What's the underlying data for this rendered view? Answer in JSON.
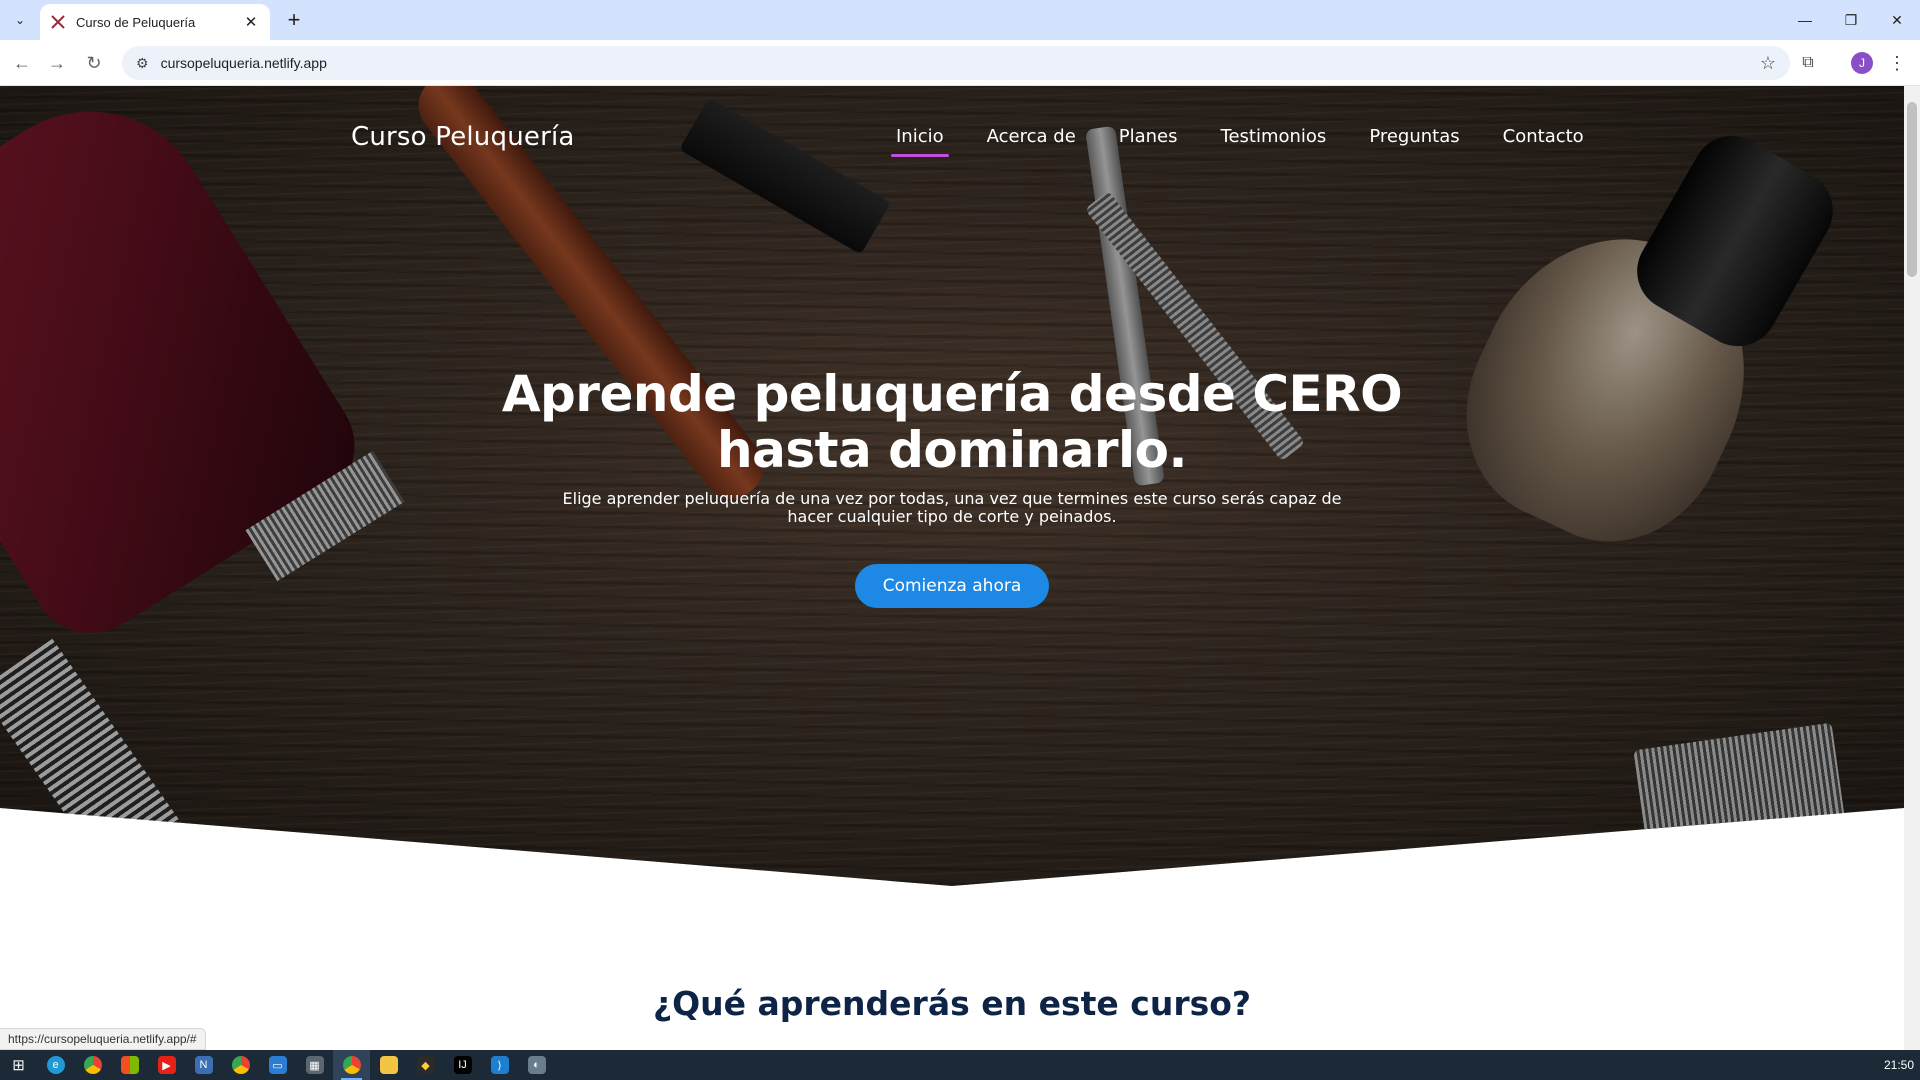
{
  "browser": {
    "tab_title": "Curso de Peluquería",
    "url": "cursopeluqueria.netlify.app",
    "avatar_letter": "J",
    "status_url": "https://cursopeluqueria.netlify.app/#"
  },
  "site": {
    "logo": "Curso Peluquería",
    "nav": [
      {
        "label": "Inicio",
        "active": true
      },
      {
        "label": "Acerca de",
        "active": false
      },
      {
        "label": "Planes",
        "active": false
      },
      {
        "label": "Testimonios",
        "active": false
      },
      {
        "label": "Preguntas",
        "active": false
      },
      {
        "label": "Contacto",
        "active": false
      }
    ],
    "hero": {
      "title_line1": "Aprende peluquería desde CERO",
      "title_line2": "hasta dominarlo.",
      "subtitle": "Elige aprender peluquería de una vez por todas, una vez que termines este curso serás capaz de hacer cualquier tipo de corte y peinados.",
      "cta_label": "Comienza ahora"
    },
    "section_title": "¿Qué aprenderás en este curso?",
    "colors": {
      "accent_underline": "#c04fe0",
      "cta": "#1e88e5",
      "section_title": "#0e2447"
    }
  },
  "taskbar": {
    "icons": [
      "start-icon",
      "edge-icon",
      "chrome-icon",
      "store-icon",
      "youtube-icon",
      "app-icon",
      "chrome-icon",
      "remote-icon",
      "calculator-icon",
      "chrome-icon",
      "explorer-icon",
      "git-icon",
      "intellij-icon",
      "vscode-icon",
      "app-icon"
    ],
    "clock": "21:50"
  }
}
